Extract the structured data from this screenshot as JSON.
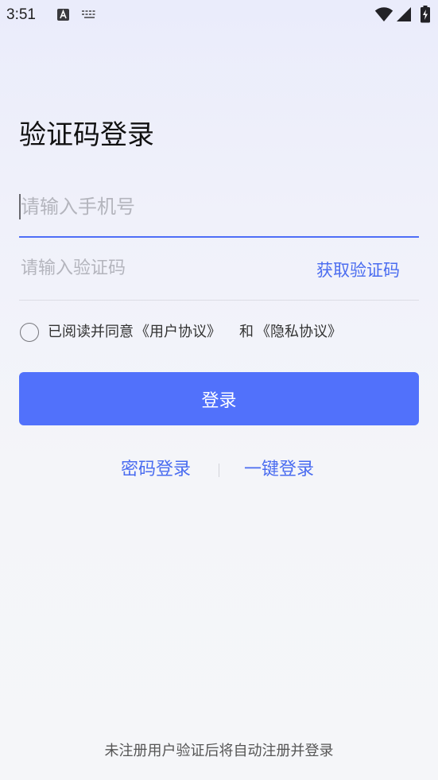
{
  "status_bar": {
    "time": "3:51",
    "icons": [
      "text-a-icon",
      "keyboard-icon",
      "wifi-icon",
      "signal-icon",
      "battery-charging-icon"
    ]
  },
  "page": {
    "title": "验证码登录"
  },
  "form": {
    "phone": {
      "value": "",
      "placeholder": "请输入手机号"
    },
    "code": {
      "value": "",
      "placeholder": "请输入验证码",
      "get_code_label": "获取验证码"
    },
    "agreement": {
      "checked": false,
      "prefix": "已阅读并同意",
      "user_agreement": "《用户协议》",
      "and": "和",
      "privacy_policy": "《隐私协议》"
    },
    "submit_label": "登录"
  },
  "alt_login": {
    "password_login": "密码登录",
    "one_click_login": "一键登录"
  },
  "footer": {
    "notice": "未注册用户验证后将自动注册并登录"
  },
  "colors": {
    "accent": "#4f6ef7",
    "button": "#5171fb",
    "link": "#4a6cf0",
    "placeholder": "#b4b5bd",
    "divider": "#dcdde4"
  }
}
